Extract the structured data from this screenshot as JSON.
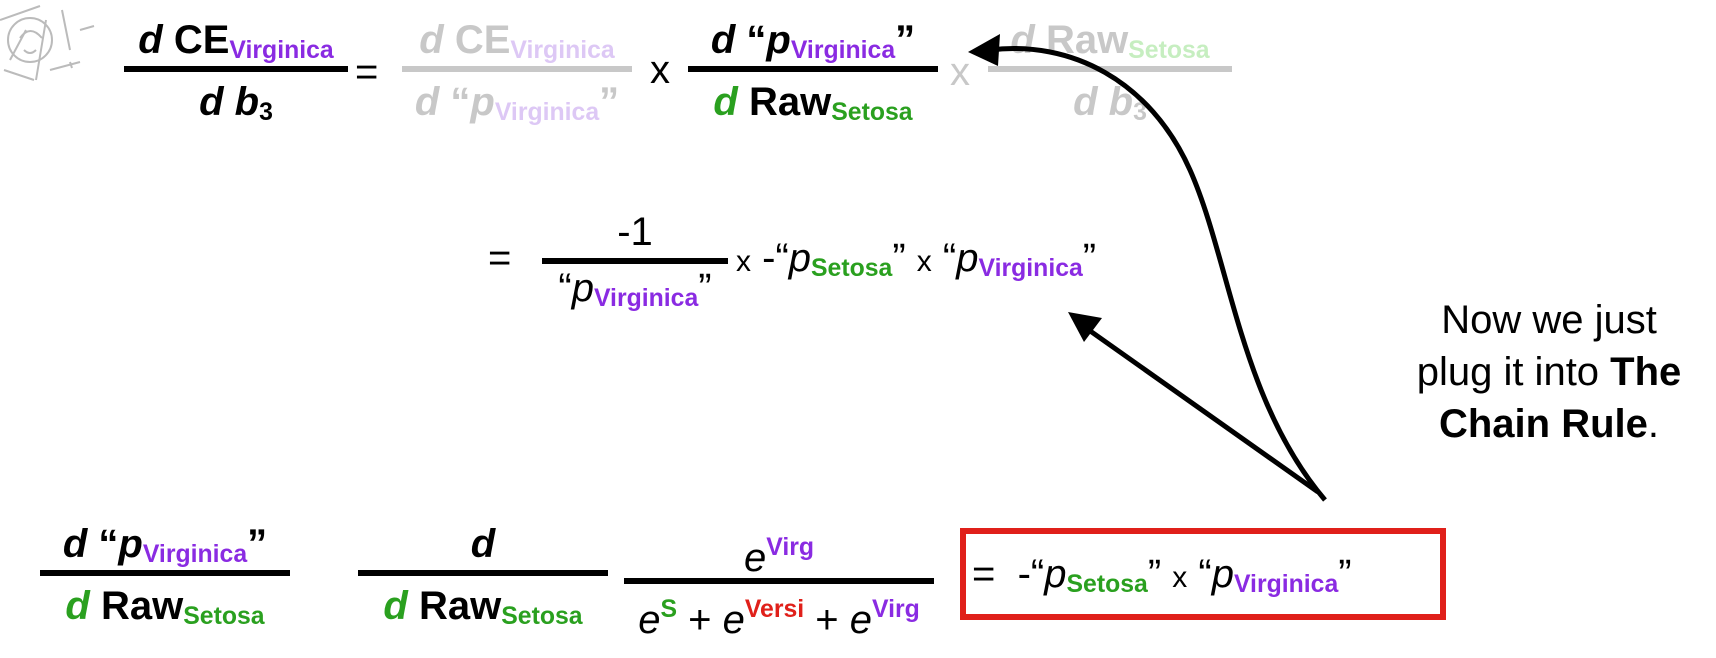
{
  "colors": {
    "green": "#2aa01f",
    "purple": "#8a2be2",
    "red": "#e0201a",
    "gray": "#c8c8c8",
    "box_border": "#e0201a"
  },
  "icon": "sketch-logo-icon",
  "top_eq": {
    "lhs_num_d": "d",
    "lhs_num_ce": "CE",
    "lhs_num_sub": "Virginica",
    "lhs_den_d": "d",
    "lhs_den_b": "b",
    "lhs_den_sub": "3",
    "equals": "=",
    "t1_num_d": "d",
    "t1_num_ce": "CE",
    "t1_num_sub": "Virginica",
    "t1_den_d": "d",
    "t1_den_open": "“",
    "t1_den_p": "p",
    "t1_den_sub": "Virginica",
    "t1_den_close": "”",
    "times1": "x",
    "t2_num_d": "d",
    "t2_num_open": "“",
    "t2_num_p": "p",
    "t2_num_sub": "Virginica",
    "t2_num_close": "”",
    "t2_den_d": "d",
    "t2_den_raw": "Raw",
    "t2_den_sub": "Setosa",
    "times2": "x",
    "t3_num_d": "d",
    "t3_num_raw": "Raw",
    "t3_num_sub": "Setosa",
    "t3_den_d": "d",
    "t3_den_b": "b",
    "t3_den_sub": "3"
  },
  "mid_eq": {
    "equals": "=",
    "frac_num": "-1",
    "frac_den_open": "“",
    "frac_den_p": "p",
    "frac_den_sub": "Virginica",
    "frac_den_close": "”",
    "times1": "x",
    "neg_open": "-“",
    "p1": "p",
    "p1_sub": "Setosa",
    "p1_close": "”",
    "times2": "x",
    "p2_open": "“",
    "p2": "p",
    "p2_sub": "Virginica",
    "p2_close": "”"
  },
  "note": {
    "line1": "Now we just",
    "line2_a": "plug it into ",
    "line2_b": "The",
    "line3": "Chain Rule",
    "line3_end": "."
  },
  "bottom_eq": {
    "l_num_d": "d",
    "l_num_open": "“",
    "l_num_p": "p",
    "l_num_sub": "Virginica",
    "l_num_close": "”",
    "l_den_d": "d",
    "l_den_raw": "Raw",
    "l_den_sub": "Setosa",
    "m_num_d": "d",
    "m_den_d": "d",
    "m_den_raw": "Raw",
    "m_den_sub": "Setosa",
    "r_num_e": "e",
    "r_num_sup": "Virg",
    "r_den_e1": "e",
    "r_den_sup1": "S",
    "r_den_plus1": "+",
    "r_den_e2": "e",
    "r_den_sup2": "Versi",
    "r_den_plus2": "+",
    "r_den_e3": "e",
    "r_den_sup3": "Virg",
    "result_equals": "=",
    "result_neg_open": "-“",
    "result_p1": "p",
    "result_p1_sub": "Setosa",
    "result_p1_close": "”",
    "result_times": "x",
    "result_p2_open": "“",
    "result_p2": "p",
    "result_p2_sub": "Virginica",
    "result_p2_close": "”"
  }
}
